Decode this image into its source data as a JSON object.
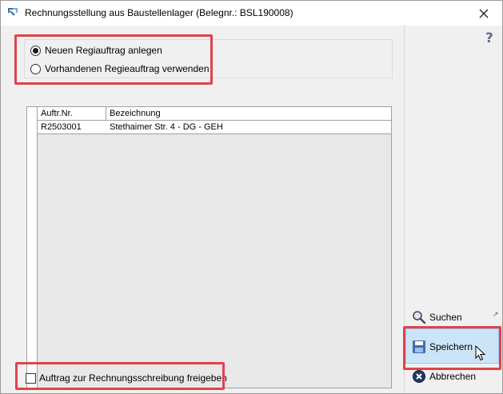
{
  "window": {
    "title": "Rechnungsstellung aus Baustellenlager (Belegnr.: BSL190008)",
    "close_glyph": "✕"
  },
  "options": {
    "items": [
      {
        "label": "Neuen Regiauftrag anlegen",
        "checked": true
      },
      {
        "label": "Vorhandenen Regieauftrag verwenden",
        "checked": false
      }
    ]
  },
  "grid": {
    "columns": [
      "Auftr.Nr.",
      "Bezeichnung"
    ],
    "rows": [
      [
        "R2503001",
        "Stethaimer Str. 4 - DG - GEH"
      ]
    ]
  },
  "release_checkbox": {
    "label": "Auftrag zur Rechnungsschreibung freigeben",
    "checked": false
  },
  "sidebar": {
    "help_label": "?",
    "search_label": "Suchen",
    "save_label": "Speichern",
    "cancel_label": "Abbrechen"
  },
  "colors": {
    "highlight": "#e0434b",
    "hover_bg": "#cce4f7",
    "hover_border": "#99c9ef"
  }
}
